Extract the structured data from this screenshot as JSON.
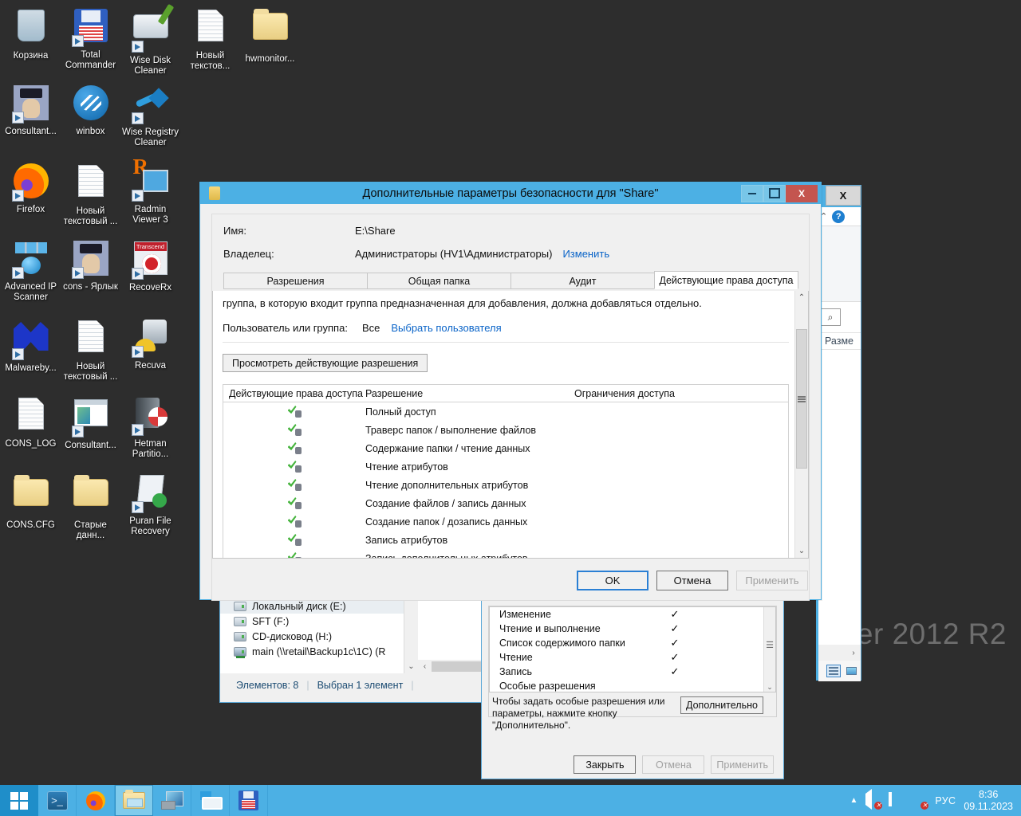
{
  "desktop": {
    "watermark": "er 2012 R2",
    "icons": [
      {
        "label": "Корзина",
        "art": "ic-bin",
        "shortcut": false
      },
      {
        "label": "Total Commander",
        "art": "ic-floppy",
        "shortcut": true
      },
      {
        "label": "Wise Disk Cleaner",
        "art": "ic-disk",
        "shortcut": true
      },
      {
        "label": "Новый текстов...",
        "art": "ic-doc",
        "shortcut": false
      },
      {
        "label": "hwmonitor...",
        "art": "ic-folder",
        "shortcut": false
      },
      {
        "label": "Consultant...",
        "art": "ic-cons",
        "shortcut": true
      },
      {
        "label": "winbox",
        "art": "ic-winbox",
        "shortcut": false
      },
      {
        "label": "Wise Registry Cleaner",
        "art": "ic-reg",
        "shortcut": true
      },
      {
        "label": "Firefox",
        "art": "ic-ff",
        "shortcut": true
      },
      {
        "label": "Новый текстовый ...",
        "art": "ic-doc",
        "shortcut": false
      },
      {
        "label": "Radmin Viewer 3",
        "art": "ic-radmin",
        "shortcut": true
      },
      {
        "label": "Advanced IP Scanner",
        "art": "ic-ipscan",
        "shortcut": true
      },
      {
        "label": "cons - Ярлык",
        "art": "ic-cons",
        "shortcut": true
      },
      {
        "label": "RecoveRx",
        "art": "ic-recoverx",
        "shortcut": true
      },
      {
        "label": "Malwareby...",
        "art": "ic-mb",
        "shortcut": true
      },
      {
        "label": "Новый текстовый ...",
        "art": "ic-doc",
        "shortcut": false
      },
      {
        "label": "Recuva",
        "art": "ic-recuva",
        "shortcut": true
      },
      {
        "label": "CONS_LOG",
        "art": "ic-doc",
        "shortcut": false
      },
      {
        "label": "Consultant...",
        "art": "ic-app",
        "shortcut": true
      },
      {
        "label": "Hetman Partitio...",
        "art": "ic-hetman",
        "shortcut": true
      },
      {
        "label": "CONS.CFG",
        "art": "ic-cfg",
        "shortcut": false
      },
      {
        "label": "Старые данн...",
        "art": "ic-cfg",
        "shortcut": false
      },
      {
        "label": "Puran File Recovery",
        "art": "ic-puran",
        "shortcut": true
      }
    ]
  },
  "advanced_dialog": {
    "title": "Дополнительные параметры безопасности  для \"Share\"",
    "window_buttons": {
      "minimize": "",
      "maximize": "",
      "close": "X"
    },
    "name_label": "Имя:",
    "name_value": "E:\\Share",
    "owner_label": "Владелец:",
    "owner_value": "Администраторы (HV1\\Администраторы)",
    "owner_change_link": "Изменить",
    "tabs": [
      {
        "label": "Разрешения",
        "active": false
      },
      {
        "label": "Общая папка",
        "active": false
      },
      {
        "label": "Аудит",
        "active": false
      },
      {
        "label": "Действующие права доступа",
        "active": true
      }
    ],
    "note": "группа, в которую входит группа предназначенная для добавления, должна добавляться отдельно.",
    "user_group_label": "Пользователь или группа:",
    "user_group_value": "Все",
    "user_group_link": "Выбрать пользователя",
    "view_effective_button": "Просмотреть действующие разрешения",
    "table": {
      "headers": [
        "Действующие права доступа",
        "Разрешение",
        "Ограничения доступа"
      ],
      "rows": [
        {
          "icon": "permission-granted-icon",
          "permission": "Полный доступ",
          "limits": ""
        },
        {
          "icon": "permission-granted-icon",
          "permission": "Траверс папок / выполнение файлов",
          "limits": ""
        },
        {
          "icon": "permission-granted-icon",
          "permission": "Содержание папки / чтение данных",
          "limits": ""
        },
        {
          "icon": "permission-granted-icon",
          "permission": "Чтение атрибутов",
          "limits": ""
        },
        {
          "icon": "permission-granted-icon",
          "permission": "Чтение дополнительных атрибутов",
          "limits": ""
        },
        {
          "icon": "permission-granted-icon",
          "permission": "Создание файлов / запись данных",
          "limits": ""
        },
        {
          "icon": "permission-granted-icon",
          "permission": "Создание папок / дозапись данных",
          "limits": ""
        },
        {
          "icon": "permission-granted-icon",
          "permission": "Запись атрибутов",
          "limits": ""
        },
        {
          "icon": "permission-granted-icon",
          "permission": "Запись дополнительных атрибутов",
          "limits": ""
        }
      ]
    },
    "buttons": {
      "ok": "OK",
      "cancel": "Отмена",
      "apply": "Применить"
    }
  },
  "explorer_window": {
    "tree_items": [
      {
        "label": "Локальный диск (E:)",
        "type": "drive",
        "selected": true
      },
      {
        "label": "SFT (F:)",
        "type": "drive",
        "selected": false
      },
      {
        "label": "CD-дисковод (H:)",
        "type": "cd",
        "selected": false
      },
      {
        "label": "main (\\\\retail\\Backup1c\\1C) (R",
        "type": "network",
        "selected": false
      }
    ],
    "status_items": [
      "Элементов: 8",
      "Выбран 1 элемент"
    ]
  },
  "properties_window": {
    "permissions": [
      {
        "label": "Изменение",
        "checked": "✓"
      },
      {
        "label": "Чтение и выполнение",
        "checked": "✓"
      },
      {
        "label": "Список содержимого папки",
        "checked": "✓"
      },
      {
        "label": "Чтение",
        "checked": "✓"
      },
      {
        "label": "Запись",
        "checked": "✓"
      },
      {
        "label": "Особые разрешения",
        "checked": ""
      }
    ],
    "hint": "Чтобы задать особые разрешения или параметры, нажмите кнопку \"Дополнительно\".",
    "advanced_button": "Дополнительно",
    "buttons": {
      "close": "Закрыть",
      "cancel": "Отмена",
      "apply": "Применить"
    }
  },
  "right_window": {
    "close_label": "X",
    "help_label": "?",
    "column_header": "Разме",
    "search_icon": "search-icon"
  },
  "taskbar": {
    "start": "start-button",
    "items": [
      {
        "name": "powershell",
        "active": false
      },
      {
        "name": "firefox",
        "active": false
      },
      {
        "name": "file-explorer",
        "active": true
      },
      {
        "name": "server-manager",
        "active": false
      },
      {
        "name": "admin-tools",
        "active": false
      },
      {
        "name": "total-commander",
        "active": false
      }
    ],
    "tray": {
      "language": "РУС",
      "time": "8:36",
      "date": "09.11.2023",
      "chevron": "▲"
    }
  }
}
